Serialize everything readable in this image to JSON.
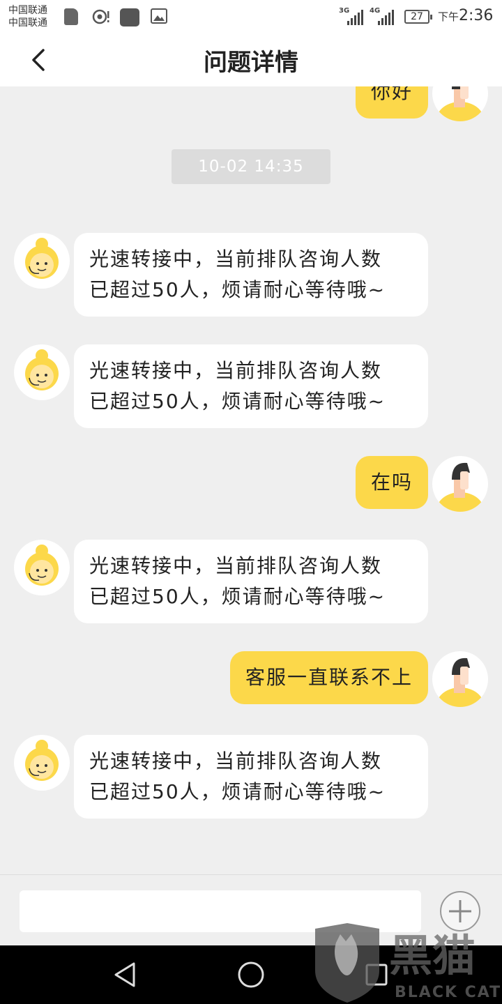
{
  "status_bar": {
    "carrier_1": "中国联通",
    "carrier_2": "中国联通",
    "network_1": "3G",
    "network_2": "4G",
    "battery": "27",
    "time_prefix": "下午",
    "time": "2:36",
    "icons": [
      "sim-card-icon",
      "hotspot-icon",
      "app-notification-icon",
      "gallery-icon",
      "signal-icon",
      "battery-icon"
    ]
  },
  "header": {
    "back_icon": "chevron-left-icon",
    "title": "问题详情"
  },
  "chat": {
    "timestamp": "10-02 14:35",
    "messages": [
      {
        "side": "right",
        "text": "你好",
        "avatar": "user-avatar-icon"
      },
      {
        "side": "left",
        "line1": "光速转接中，当前排队咨询人数",
        "line2": "已超过50人，烦请耐心等待哦~",
        "avatar": "agent-avatar-icon"
      },
      {
        "side": "left",
        "line1": "光速转接中，当前排队咨询人数",
        "line2": "已超过50人，烦请耐心等待哦~",
        "avatar": "agent-avatar-icon"
      },
      {
        "side": "right",
        "text": "在吗",
        "avatar": "user-avatar-icon"
      },
      {
        "side": "left",
        "line1": "光速转接中，当前排队咨询人数",
        "line2": "已超过50人，烦请耐心等待哦~",
        "avatar": "agent-avatar-icon"
      },
      {
        "side": "right",
        "text": "客服一直联系不上",
        "avatar": "user-avatar-icon"
      },
      {
        "side": "left",
        "line1": "光速转接中，当前排队咨询人数",
        "line2": "已超过50人，烦请耐心等待哦~",
        "avatar": "agent-avatar-icon"
      }
    ]
  },
  "input_bar": {
    "value": "",
    "add_icon": "plus-circle-icon"
  },
  "nav_bar": {
    "icons": [
      "back-triangle-icon",
      "home-circle-icon",
      "recents-square-icon"
    ]
  },
  "watermark": {
    "text_cn": "黑猫",
    "text_en": "BLACK CAT"
  },
  "colors": {
    "accent_yellow": "#fcd84a",
    "background": "#efefef",
    "agent_bubble": "#ffffff"
  }
}
